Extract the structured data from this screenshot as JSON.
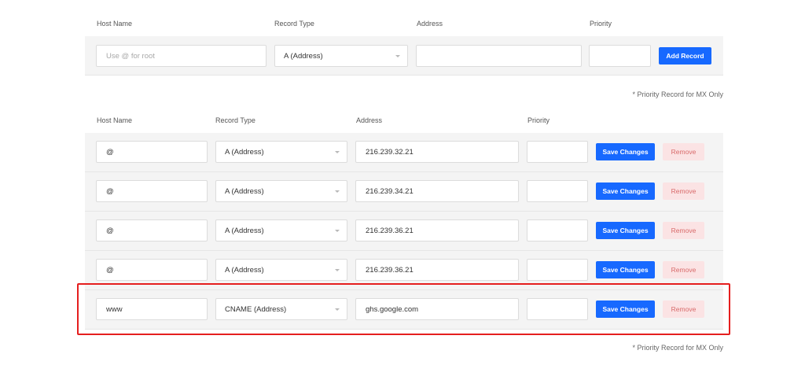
{
  "add_form": {
    "headers": {
      "host": "Host Name",
      "type": "Record Type",
      "address": "Address",
      "priority": "Priority"
    },
    "host_placeholder": "Use @ for root",
    "type_value": "A (Address)",
    "address_value": "",
    "priority_value": "",
    "add_label": "Add Record",
    "note": "* Priority Record for MX Only"
  },
  "records": {
    "headers": {
      "host": "Host Name",
      "type": "Record Type",
      "address": "Address",
      "priority": "Priority"
    },
    "rows": [
      {
        "host": "@",
        "type": "A (Address)",
        "address": "216.239.32.21",
        "priority": "",
        "save_label": "Save Changes",
        "remove_label": "Remove"
      },
      {
        "host": "@",
        "type": "A (Address)",
        "address": "216.239.34.21",
        "priority": "",
        "save_label": "Save Changes",
        "remove_label": "Remove"
      },
      {
        "host": "@",
        "type": "A (Address)",
        "address": "216.239.36.21",
        "priority": "",
        "save_label": "Save Changes",
        "remove_label": "Remove"
      },
      {
        "host": "@",
        "type": "A (Address)",
        "address": "216.239.36.21",
        "priority": "",
        "save_label": "Save Changes",
        "remove_label": "Remove"
      },
      {
        "host": "www",
        "type": "CNAME (Address)",
        "address": "ghs.google.com",
        "priority": "",
        "save_label": "Save Changes",
        "remove_label": "Remove"
      }
    ],
    "note": "* Priority Record for MX Only"
  },
  "colors": {
    "primary": "#1769ff",
    "remove_bg": "#fbe3e4",
    "remove_text": "#d86a6a",
    "highlight": "#e51e1e",
    "band": "#f4f4f4"
  },
  "icons": {
    "select_caret": "chevron-down-icon"
  }
}
